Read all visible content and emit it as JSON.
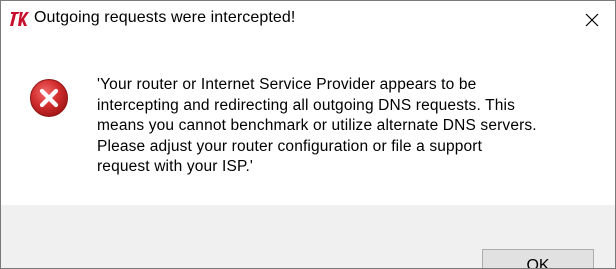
{
  "window": {
    "title": "Outgoing requests were intercepted!",
    "app_icon": "tk-feather-icon",
    "close_icon": "close-icon"
  },
  "dialog": {
    "icon": "error-icon",
    "message": "'Your router or Internet Service Provider appears to be\nintercepting and redirecting all outgoing DNS requests. This\nmeans you cannot benchmark or utilize alternate DNS servers.\nPlease adjust your router configuration or file a support\nrequest with your ISP.'"
  },
  "buttons": {
    "ok_label": "OK"
  },
  "colors": {
    "error_red": "#d32f2f",
    "footer_bg": "#f0f0f0",
    "button_bg": "#e1e1e1",
    "button_border": "#adadad"
  }
}
